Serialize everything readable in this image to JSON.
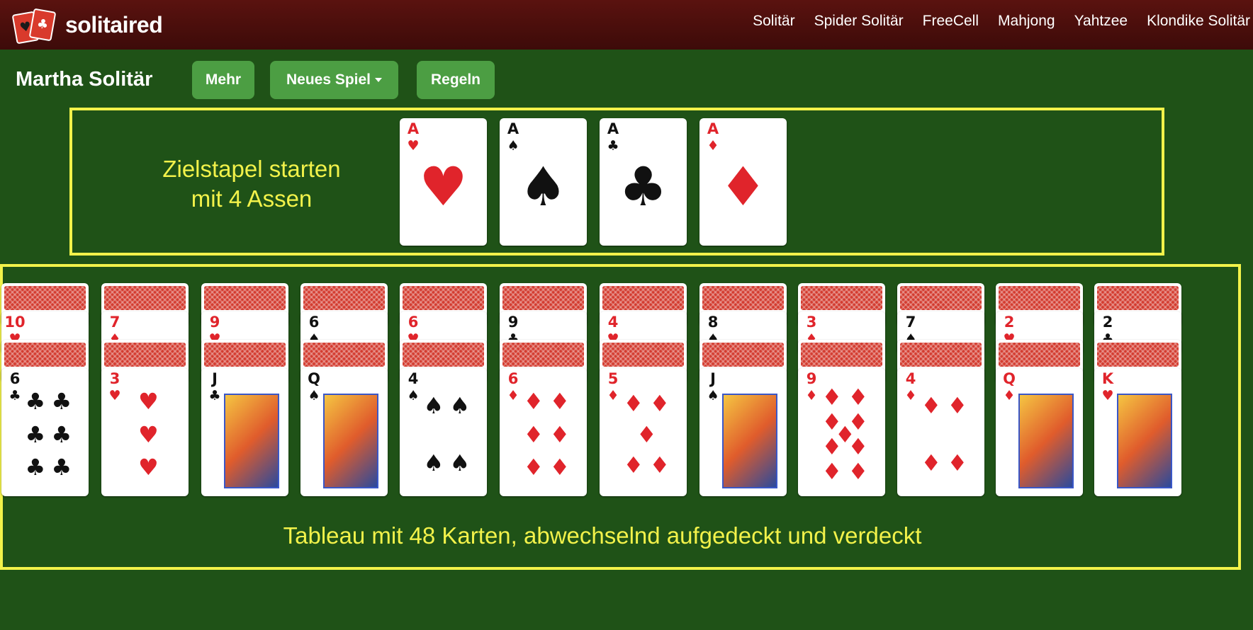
{
  "header": {
    "brand": "solitaired",
    "nav": [
      "Solitär",
      "Spider Solitär",
      "FreeCell",
      "Mahjong",
      "Yahtzee",
      "Klondike Solitär"
    ]
  },
  "toolbar": {
    "title": "Martha Solitär",
    "buttons": [
      "Mehr",
      "Neues Spiel",
      "Regeln"
    ]
  },
  "annotations": {
    "foundation_line1": "Zielstapel starten",
    "foundation_line2": "mit 4 Assen",
    "tableau": "Tableau mit 48 Karten, abwechselnd aufgedeckt und verdeckt"
  },
  "colors": {
    "felt": "#1f5217",
    "highlight": "#f2f24a",
    "button": "#4c9e43",
    "header": "#4a0f0c"
  },
  "foundations": [
    {
      "rank": "A",
      "suit": "♥"
    },
    {
      "rank": "A",
      "suit": "♠"
    },
    {
      "rank": "A",
      "suit": "♣"
    },
    {
      "rank": "A",
      "suit": "♦"
    }
  ],
  "tableau": [
    {
      "upper": {
        "rank": "10",
        "suit": "♥"
      },
      "top": {
        "rank": "6",
        "suit": "♣"
      }
    },
    {
      "upper": {
        "rank": "7",
        "suit": "♦"
      },
      "top": {
        "rank": "3",
        "suit": "♥"
      }
    },
    {
      "upper": {
        "rank": "9",
        "suit": "♥"
      },
      "top": {
        "rank": "J",
        "suit": "♣"
      }
    },
    {
      "upper": {
        "rank": "6",
        "suit": "♠"
      },
      "top": {
        "rank": "Q",
        "suit": "♠"
      }
    },
    {
      "upper": {
        "rank": "6",
        "suit": "♥"
      },
      "top": {
        "rank": "4",
        "suit": "♠"
      }
    },
    {
      "upper": {
        "rank": "9",
        "suit": "♣"
      },
      "top": {
        "rank": "6",
        "suit": "♦"
      }
    },
    {
      "upper": {
        "rank": "4",
        "suit": "♥"
      },
      "top": {
        "rank": "5",
        "suit": "♦"
      }
    },
    {
      "upper": {
        "rank": "8",
        "suit": "♠"
      },
      "top": {
        "rank": "J",
        "suit": "♠"
      }
    },
    {
      "upper": {
        "rank": "3",
        "suit": "♦"
      },
      "top": {
        "rank": "9",
        "suit": "♦"
      }
    },
    {
      "upper": {
        "rank": "7",
        "suit": "♠"
      },
      "top": {
        "rank": "4",
        "suit": "♦"
      }
    },
    {
      "upper": {
        "rank": "2",
        "suit": "♥"
      },
      "top": {
        "rank": "Q",
        "suit": "♦"
      }
    },
    {
      "upper": {
        "rank": "2",
        "suit": "♣"
      },
      "top": {
        "rank": "K",
        "suit": "♥"
      }
    }
  ]
}
